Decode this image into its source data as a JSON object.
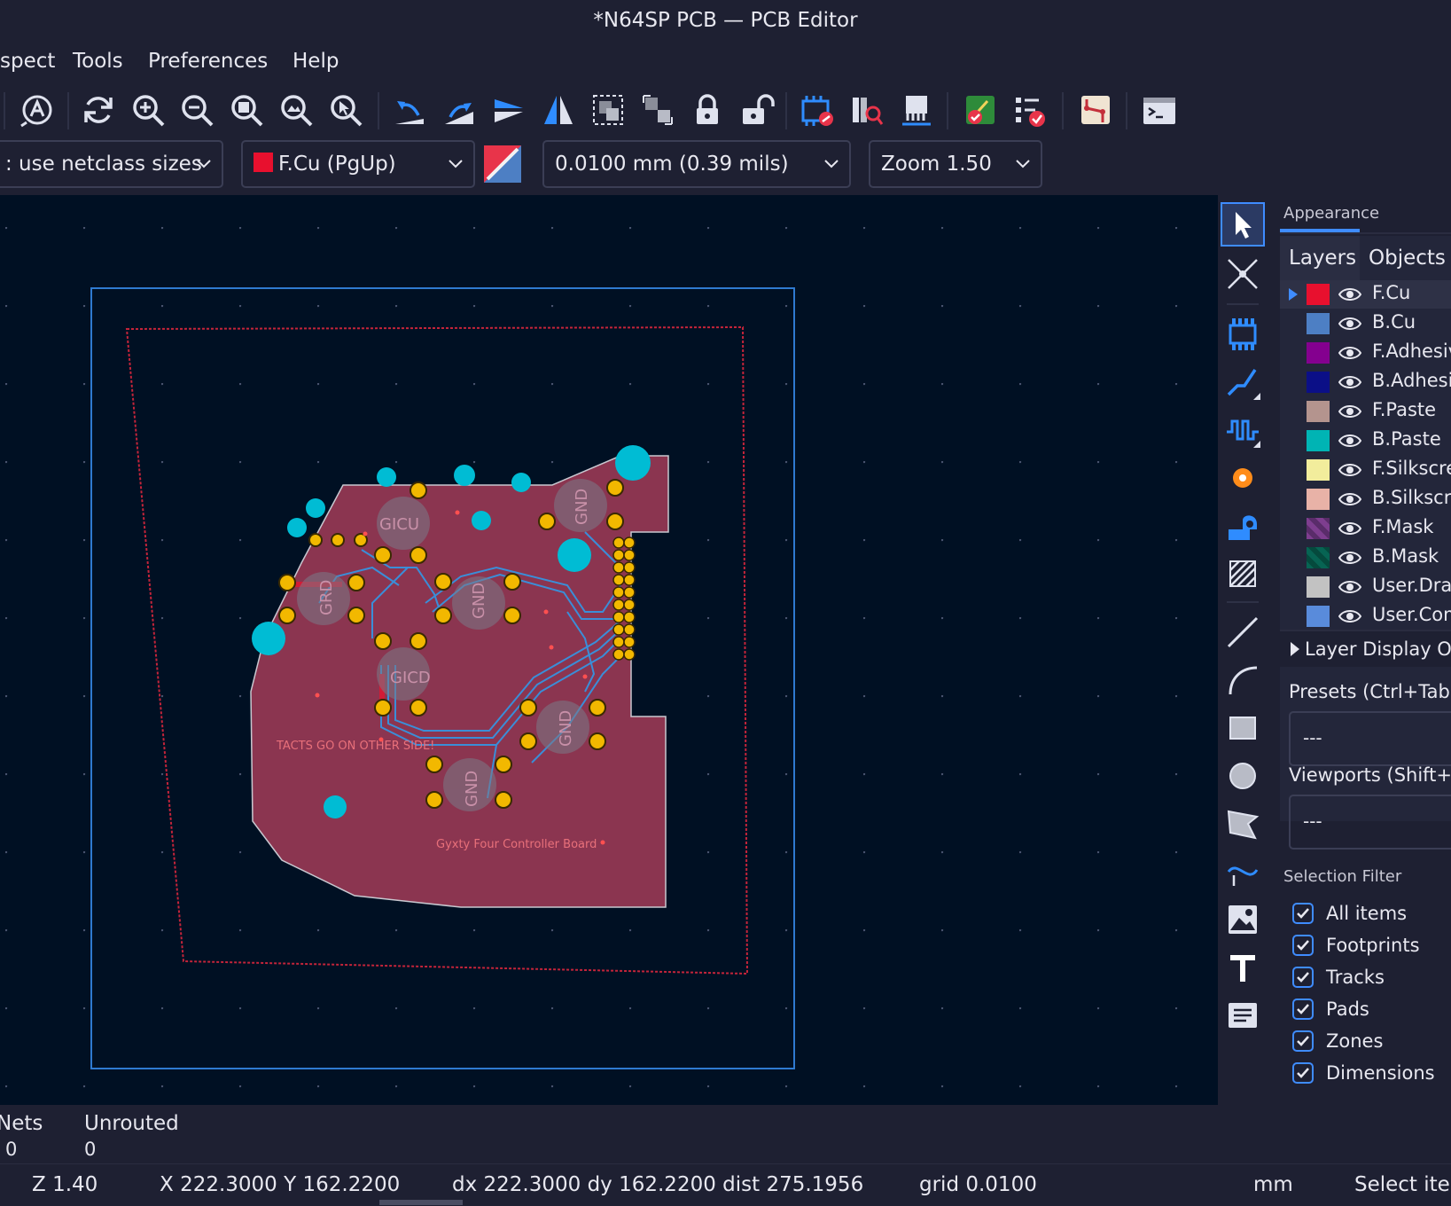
{
  "window": {
    "title": "*N64SP PCB — PCB Editor"
  },
  "menu": [
    "spect",
    "Tools",
    "Preferences",
    "Help"
  ],
  "toolbar_icons": [
    "edit-text-icon",
    "refresh-icon",
    "zoom-in-icon",
    "zoom-out-icon",
    "zoom-fit-icon",
    "zoom-objects-icon",
    "zoom-selection-icon",
    "undo-icon",
    "redo-icon",
    "flip-icon",
    "mirror-icon",
    "group-icon",
    "ungroup-icon",
    "lock-icon",
    "unlock-icon",
    "netlist-update-icon",
    "library-browser-icon",
    "footprint-editor-icon",
    "drc-icon",
    "board-setup-icon",
    "route-icon",
    "scripting-console-icon"
  ],
  "toolbar2": {
    "track_width": ": use netclass sizes",
    "layer": "F.Cu (PgUp)",
    "layer_color": "#e8102e",
    "grid": "0.0100 mm (0.39 mils)",
    "zoom": "Zoom 1.50"
  },
  "vertical_tools": [
    "select-arrow-icon",
    "local-ratsnest-icon",
    "place-footprint-icon",
    "route-track-icon",
    "tune-length-icon",
    "via-icon",
    "teardrop-icon",
    "zone-icon",
    "line-icon",
    "arc-icon",
    "rectangle-icon",
    "circle-icon",
    "polygon-icon",
    "bezier-icon",
    "image-icon",
    "text-icon",
    "textbox-icon"
  ],
  "board_labels": {
    "tacts": "TACTS GO ON OTHER SIDE!",
    "board_name": "Gyxty Four Controller Board",
    "gnd": "GND",
    "gicu": "GICU",
    "gicd": "GICD",
    "grd": "GRD"
  },
  "appearance": {
    "title": "Appearance",
    "tabs": [
      "Layers",
      "Objects"
    ],
    "layers": [
      {
        "name": "F.Cu",
        "color": "#e8102e"
      },
      {
        "name": "B.Cu",
        "color": "#4d7fc4"
      },
      {
        "name": "F.Adhesive",
        "color": "#84008f"
      },
      {
        "name": "B.Adhesive",
        "color": "#0b0f87"
      },
      {
        "name": "F.Paste",
        "color": "#b4948e"
      },
      {
        "name": "B.Paste",
        "color": "#00b4b4"
      },
      {
        "name": "F.Silkscreen",
        "color": "#f2ed9c"
      },
      {
        "name": "B.Silkscreen",
        "color": "#e8b2a7"
      },
      {
        "name": "F.Mask",
        "color": "#7e3e8f"
      },
      {
        "name": "B.Mask",
        "color": "#076453"
      },
      {
        "name": "User.Drawings",
        "color": "#c2c2c2"
      },
      {
        "name": "User.Comments",
        "color": "#598bdb"
      }
    ],
    "layer_display_options": "Layer Display Options",
    "presets_label": "Presets (Ctrl+Tab):",
    "presets_value": "---",
    "viewports_label": "Viewports (Shift+Tab):",
    "viewports_value": "---",
    "selection_filter_title": "Selection Filter",
    "filters": [
      "All items",
      "Footprints",
      "Tracks",
      "Pads",
      "Zones",
      "Dimensions"
    ]
  },
  "messages": {
    "nets_label": "Nets",
    "nets_value": "0",
    "unrouted_label": "Unrouted",
    "unrouted_value": "0"
  },
  "status": {
    "zoom": "Z 1.40",
    "xy": "X 222.3000  Y 162.2200",
    "delta": "dx 222.3000  dy 162.2200  dist 275.1956",
    "grid": "grid 0.0100",
    "units": "mm",
    "mode": "Select item(s)"
  }
}
